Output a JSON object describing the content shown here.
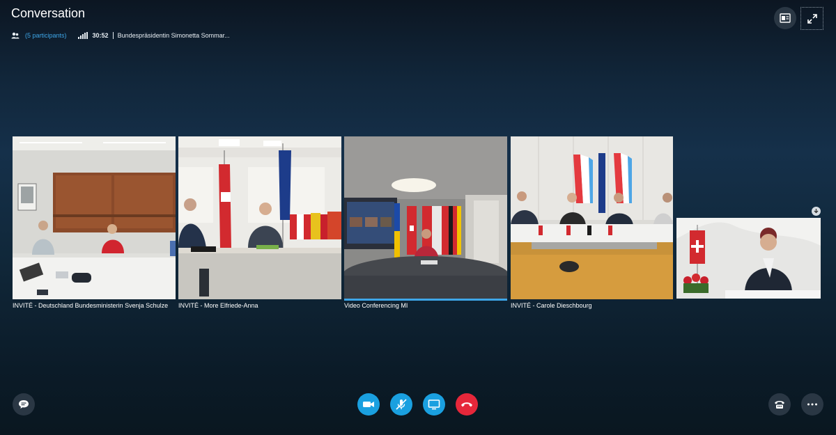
{
  "header": {
    "title": "Conversation",
    "participants": "(5 participants)",
    "timer": "30:52",
    "call_name": "Bundespräsidentin Simonetta Sommar..."
  },
  "tiles": [
    {
      "caption": "INVITÉ - Deutschland Bundesministerin Svenja Schulze"
    },
    {
      "caption": "INVITÉ - More Elfriede-Anna"
    },
    {
      "caption": "Video Conferencing MI",
      "active": true
    },
    {
      "caption": "INVITÉ - Carole Dieschbourg"
    }
  ],
  "icons": {
    "participants": "people-icon",
    "signal": "signal-strength-icon",
    "layout": "layout-icon",
    "fullscreen": "expand-icon",
    "chat": "chat-icon",
    "video": "video-camera-icon",
    "mic": "microphone-muted-icon",
    "share": "screen-share-icon",
    "hangup": "hang-up-icon",
    "dialpad": "dial-pad-icon",
    "more": "more-icon",
    "download": "download-icon"
  },
  "colors": {
    "accent": "#1aa0e0",
    "hangup": "#e6273a",
    "link": "#3ea6e8"
  }
}
